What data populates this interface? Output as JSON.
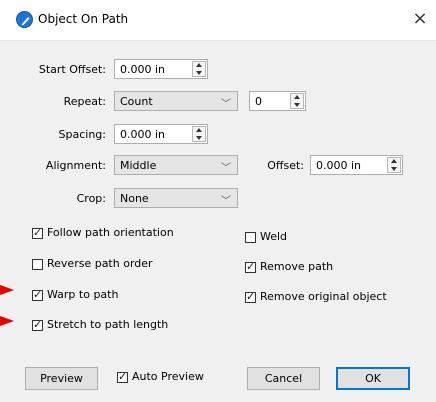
{
  "window": {
    "title": "Object On Path",
    "close_label": "×",
    "icon": "pen-circle-icon"
  },
  "form": {
    "start_offset": {
      "label": "Start Offset:",
      "value": "0.000 in"
    },
    "repeat": {
      "label": "Repeat:",
      "selected": "Count",
      "count_value": "0"
    },
    "spacing": {
      "label": "Spacing:",
      "value": "0.000 in"
    },
    "alignment": {
      "label": "Alignment:",
      "selected": "Middle"
    },
    "offset": {
      "label": "Offset:",
      "value": "0.000 in"
    },
    "crop": {
      "label": "Crop:",
      "selected": "None"
    }
  },
  "options": {
    "follow_path_orientation": {
      "label": "Follow path orientation",
      "checked": true
    },
    "reverse_path_order": {
      "label": "Reverse path order",
      "checked": false
    },
    "warp_to_path": {
      "label": "Warp to path",
      "checked": true
    },
    "stretch_to_path_length": {
      "label": "Stretch to path length",
      "checked": true
    },
    "weld": {
      "label": "Weld",
      "checked": false
    },
    "remove_path": {
      "label": "Remove path",
      "checked": true
    },
    "remove_original_object": {
      "label": "Remove original object",
      "checked": true
    }
  },
  "footer": {
    "preview_label": "Preview",
    "auto_preview": {
      "label": "Auto Preview",
      "checked": true
    },
    "cancel_label": "Cancel",
    "ok_label": "OK"
  },
  "colors": {
    "accent": "#0078d7",
    "annotation_arrow": "#e80000",
    "title_icon": "#1e73d8"
  }
}
